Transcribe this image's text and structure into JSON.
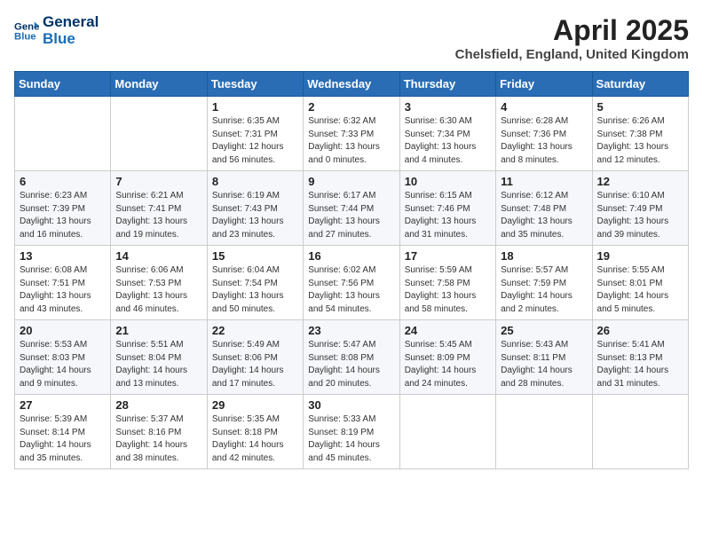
{
  "header": {
    "logo_general": "General",
    "logo_blue": "Blue",
    "month_title": "April 2025",
    "location": "Chelsfield, England, United Kingdom"
  },
  "days_of_week": [
    "Sunday",
    "Monday",
    "Tuesday",
    "Wednesday",
    "Thursday",
    "Friday",
    "Saturday"
  ],
  "weeks": [
    [
      {
        "day": "",
        "info": ""
      },
      {
        "day": "",
        "info": ""
      },
      {
        "day": "1",
        "info": "Sunrise: 6:35 AM\nSunset: 7:31 PM\nDaylight: 12 hours and 56 minutes."
      },
      {
        "day": "2",
        "info": "Sunrise: 6:32 AM\nSunset: 7:33 PM\nDaylight: 13 hours and 0 minutes."
      },
      {
        "day": "3",
        "info": "Sunrise: 6:30 AM\nSunset: 7:34 PM\nDaylight: 13 hours and 4 minutes."
      },
      {
        "day": "4",
        "info": "Sunrise: 6:28 AM\nSunset: 7:36 PM\nDaylight: 13 hours and 8 minutes."
      },
      {
        "day": "5",
        "info": "Sunrise: 6:26 AM\nSunset: 7:38 PM\nDaylight: 13 hours and 12 minutes."
      }
    ],
    [
      {
        "day": "6",
        "info": "Sunrise: 6:23 AM\nSunset: 7:39 PM\nDaylight: 13 hours and 16 minutes."
      },
      {
        "day": "7",
        "info": "Sunrise: 6:21 AM\nSunset: 7:41 PM\nDaylight: 13 hours and 19 minutes."
      },
      {
        "day": "8",
        "info": "Sunrise: 6:19 AM\nSunset: 7:43 PM\nDaylight: 13 hours and 23 minutes."
      },
      {
        "day": "9",
        "info": "Sunrise: 6:17 AM\nSunset: 7:44 PM\nDaylight: 13 hours and 27 minutes."
      },
      {
        "day": "10",
        "info": "Sunrise: 6:15 AM\nSunset: 7:46 PM\nDaylight: 13 hours and 31 minutes."
      },
      {
        "day": "11",
        "info": "Sunrise: 6:12 AM\nSunset: 7:48 PM\nDaylight: 13 hours and 35 minutes."
      },
      {
        "day": "12",
        "info": "Sunrise: 6:10 AM\nSunset: 7:49 PM\nDaylight: 13 hours and 39 minutes."
      }
    ],
    [
      {
        "day": "13",
        "info": "Sunrise: 6:08 AM\nSunset: 7:51 PM\nDaylight: 13 hours and 43 minutes."
      },
      {
        "day": "14",
        "info": "Sunrise: 6:06 AM\nSunset: 7:53 PM\nDaylight: 13 hours and 46 minutes."
      },
      {
        "day": "15",
        "info": "Sunrise: 6:04 AM\nSunset: 7:54 PM\nDaylight: 13 hours and 50 minutes."
      },
      {
        "day": "16",
        "info": "Sunrise: 6:02 AM\nSunset: 7:56 PM\nDaylight: 13 hours and 54 minutes."
      },
      {
        "day": "17",
        "info": "Sunrise: 5:59 AM\nSunset: 7:58 PM\nDaylight: 13 hours and 58 minutes."
      },
      {
        "day": "18",
        "info": "Sunrise: 5:57 AM\nSunset: 7:59 PM\nDaylight: 14 hours and 2 minutes."
      },
      {
        "day": "19",
        "info": "Sunrise: 5:55 AM\nSunset: 8:01 PM\nDaylight: 14 hours and 5 minutes."
      }
    ],
    [
      {
        "day": "20",
        "info": "Sunrise: 5:53 AM\nSunset: 8:03 PM\nDaylight: 14 hours and 9 minutes."
      },
      {
        "day": "21",
        "info": "Sunrise: 5:51 AM\nSunset: 8:04 PM\nDaylight: 14 hours and 13 minutes."
      },
      {
        "day": "22",
        "info": "Sunrise: 5:49 AM\nSunset: 8:06 PM\nDaylight: 14 hours and 17 minutes."
      },
      {
        "day": "23",
        "info": "Sunrise: 5:47 AM\nSunset: 8:08 PM\nDaylight: 14 hours and 20 minutes."
      },
      {
        "day": "24",
        "info": "Sunrise: 5:45 AM\nSunset: 8:09 PM\nDaylight: 14 hours and 24 minutes."
      },
      {
        "day": "25",
        "info": "Sunrise: 5:43 AM\nSunset: 8:11 PM\nDaylight: 14 hours and 28 minutes."
      },
      {
        "day": "26",
        "info": "Sunrise: 5:41 AM\nSunset: 8:13 PM\nDaylight: 14 hours and 31 minutes."
      }
    ],
    [
      {
        "day": "27",
        "info": "Sunrise: 5:39 AM\nSunset: 8:14 PM\nDaylight: 14 hours and 35 minutes."
      },
      {
        "day": "28",
        "info": "Sunrise: 5:37 AM\nSunset: 8:16 PM\nDaylight: 14 hours and 38 minutes."
      },
      {
        "day": "29",
        "info": "Sunrise: 5:35 AM\nSunset: 8:18 PM\nDaylight: 14 hours and 42 minutes."
      },
      {
        "day": "30",
        "info": "Sunrise: 5:33 AM\nSunset: 8:19 PM\nDaylight: 14 hours and 45 minutes."
      },
      {
        "day": "",
        "info": ""
      },
      {
        "day": "",
        "info": ""
      },
      {
        "day": "",
        "info": ""
      }
    ]
  ]
}
